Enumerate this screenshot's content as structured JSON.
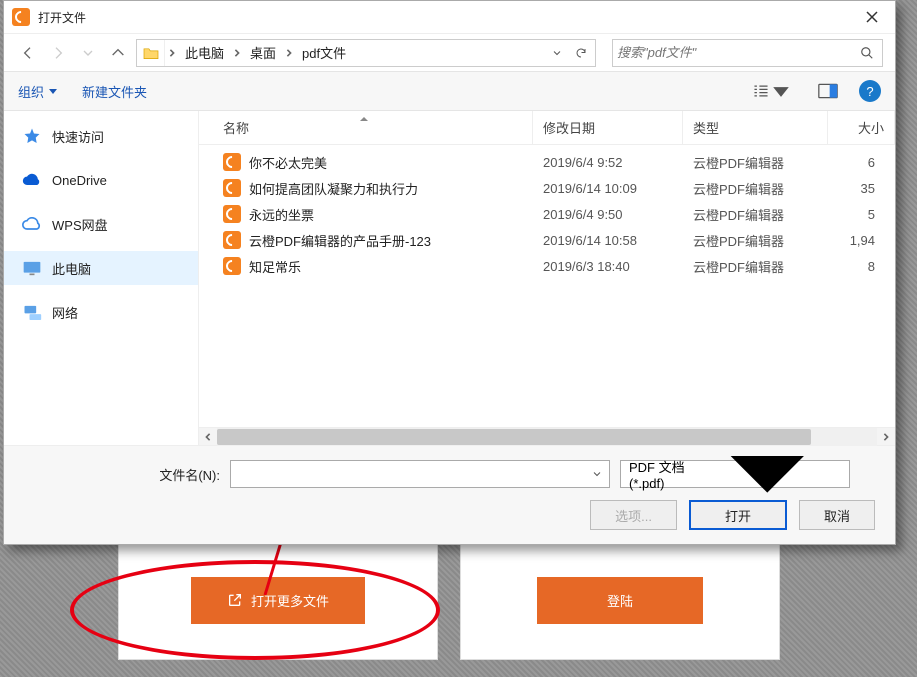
{
  "titlebar": {
    "title": "打开文件"
  },
  "breadcrumbs": [
    "此电脑",
    "桌面",
    "pdf文件"
  ],
  "search": {
    "placeholder": "搜索\"pdf文件\""
  },
  "toolbar": {
    "organize": "组织",
    "new_folder": "新建文件夹"
  },
  "sidebar": {
    "items": [
      {
        "label": "快速访问",
        "icon": "star"
      },
      {
        "label": "OneDrive",
        "icon": "cloud-blue"
      },
      {
        "label": "WPS网盘",
        "icon": "cloud-outline"
      },
      {
        "label": "此电脑",
        "icon": "monitor",
        "selected": true
      },
      {
        "label": "网络",
        "icon": "network"
      }
    ]
  },
  "columns": {
    "name": "名称",
    "date": "修改日期",
    "type": "类型",
    "size": "大小"
  },
  "files": [
    {
      "name": "你不必太完美",
      "date": "2019/6/4 9:52",
      "type": "云橙PDF编辑器",
      "size": "6"
    },
    {
      "name": "如何提高团队凝聚力和执行力",
      "date": "2019/6/14 10:09",
      "type": "云橙PDF编辑器",
      "size": "35"
    },
    {
      "name": "永远的坐票",
      "date": "2019/6/4 9:50",
      "type": "云橙PDF编辑器",
      "size": "5"
    },
    {
      "name": "云橙PDF编辑器的产品手册-123",
      "date": "2019/6/14 10:58",
      "type": "云橙PDF编辑器",
      "size": "1,94"
    },
    {
      "name": "知足常乐",
      "date": "2019/6/3 18:40",
      "type": "云橙PDF编辑器",
      "size": "8"
    }
  ],
  "footer": {
    "filename_label": "文件名(N):",
    "filetype": "PDF 文档 (*.pdf)",
    "options_btn": "选项...",
    "open_btn": "打开",
    "cancel_btn": "取消"
  },
  "bg_buttons": {
    "open_more": "打开更多文件",
    "login": "登陆"
  }
}
